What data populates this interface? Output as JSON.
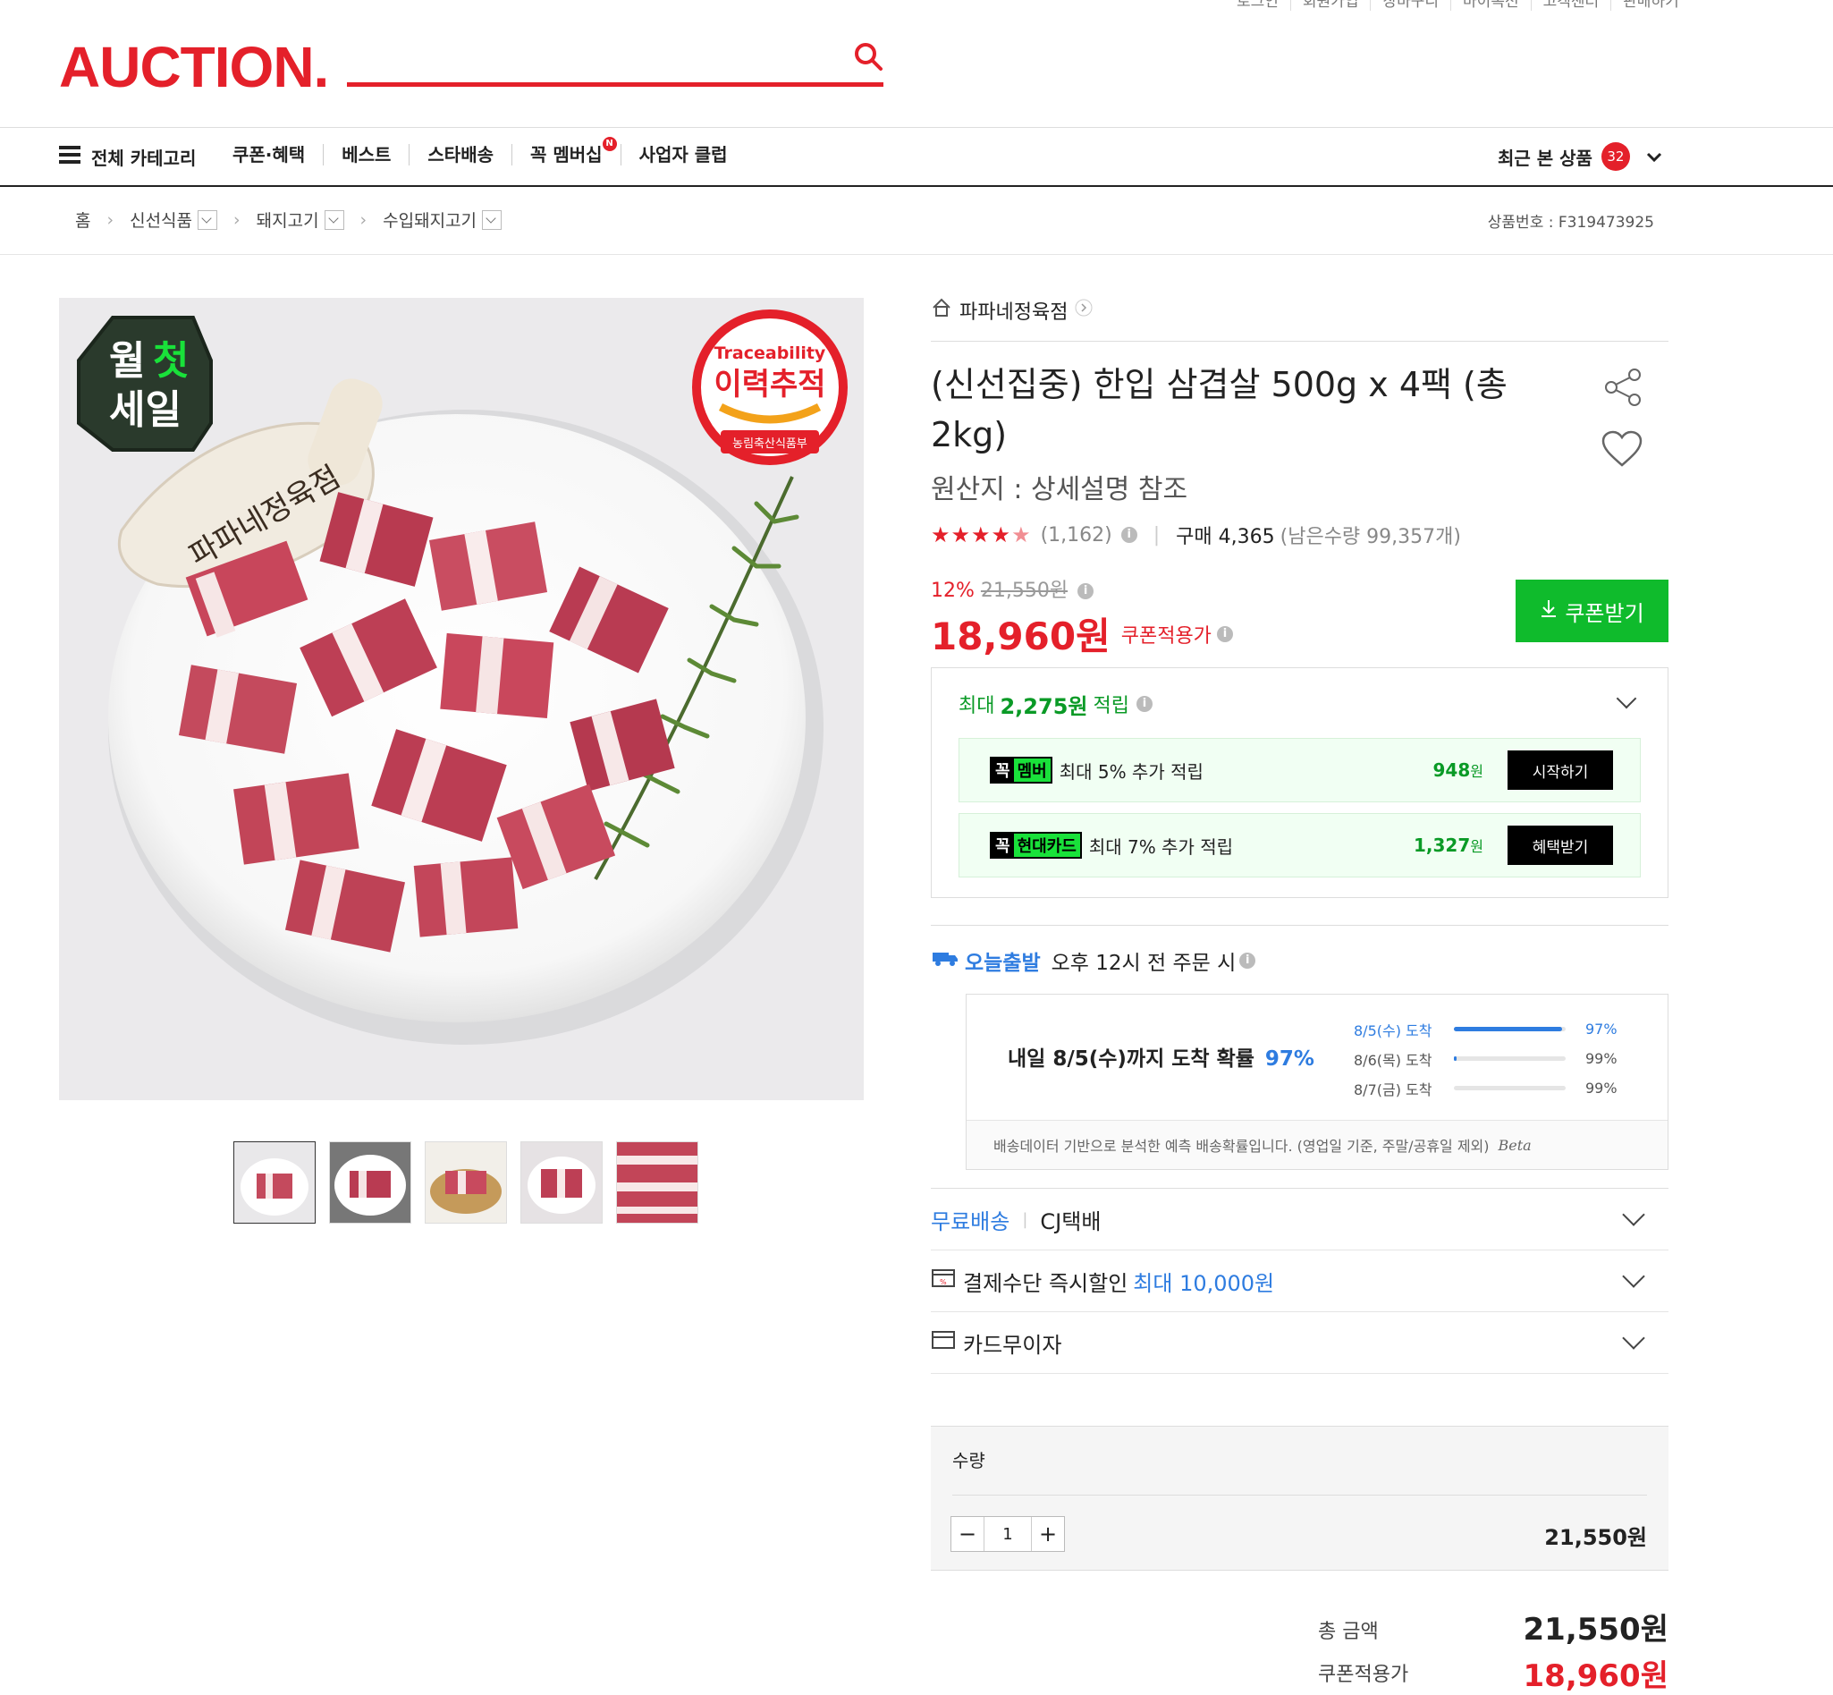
{
  "utility_links": [
    "로그인",
    "회원가입",
    "장바구니",
    "마이옥션",
    "고객센터",
    "판매하기"
  ],
  "header": {
    "logo": "AUCTION.",
    "search_placeholder": ""
  },
  "nav": {
    "all_categories": "전체 카테고리",
    "links": [
      "쿠폰·혜택",
      "베스트",
      "스타배송",
      "꼭 멤버십",
      "사업자 클럽"
    ],
    "membership_badge": "N",
    "recent_label": "최근 본 상품",
    "recent_count": "32"
  },
  "breadcrumb": {
    "home": "홈",
    "items": [
      "신선식품",
      "돼지고기",
      "수입돼지고기"
    ],
    "product_no": "상품번호 : F319473925"
  },
  "product_image": {
    "badge_left": [
      "월",
      "첫",
      "세일"
    ],
    "badge_right_top": "Traceability",
    "badge_right_main": "이력추적",
    "badge_right_sub": "농림축산식품부",
    "brand_on_mushroom": "파파네정육점"
  },
  "seller": "파파네정육점",
  "title": "(신선집중) 한입 삼겹살 500g x 4팩 (총 2kg)",
  "origin": "원산지 : 상세설명 참조",
  "rating": {
    "stars": 4.5,
    "review_count": "(1,162)"
  },
  "purchase": {
    "label": "구매 4,365",
    "remaining": "(남은수량 99,357개)"
  },
  "price": {
    "discount": "12%",
    "original": "21,550원",
    "final": "18,960원",
    "final_label": "쿠폰적용가",
    "coupon_button": "쿠폰받기"
  },
  "rewards": {
    "max_prefix": "최대",
    "max_amount": "2,275원",
    "max_suffix": "적립",
    "rows": [
      {
        "tag_a": "꼭",
        "tag_b": "멤버",
        "text": "최대 5% 추가 적립",
        "amount": "948",
        "unit": "원",
        "button": "시작하기"
      },
      {
        "tag_a": "꼭",
        "tag_b": "현대카드",
        "text": "최대 7% 추가 적립",
        "amount": "1,327",
        "unit": "원",
        "button": "혜택받기"
      }
    ]
  },
  "delivery": {
    "today_label": "오늘출발",
    "today_condition": "오후 12시 전 주문 시",
    "prob_text": "내일 8/5(수)까지 도착 확률",
    "prob_value": "97%",
    "rows": [
      {
        "label": "8/5(수) 도착",
        "pct": "97%",
        "fill": 0.97
      },
      {
        "label": "8/6(목) 도착",
        "pct": "99%",
        "fill": 0.02
      },
      {
        "label": "8/7(금) 도착",
        "pct": "99%",
        "fill": 0.0
      }
    ],
    "note": "배송데이터 기반으로 분석한 예측 배송확률입니다. (영업일 기준, 주말/공휴일 제외)",
    "beta": "Beta"
  },
  "shipping": {
    "free": "무료배송",
    "carrier": "CJ택배"
  },
  "payment_discount": {
    "label": "결제수단 즉시할인",
    "value": "최대 10,000원"
  },
  "card_interest": "카드무이자",
  "quantity": {
    "label": "수량",
    "value": "1",
    "price": "21,550원"
  },
  "totals": {
    "total_label": "총 금액",
    "total_value": "21,550원",
    "coupon_label": "쿠폰적용가",
    "coupon_value": "18,960원"
  },
  "colors": {
    "brand_red": "#e4202a",
    "green": "#0fbb2c",
    "blue": "#2e7ce0"
  }
}
